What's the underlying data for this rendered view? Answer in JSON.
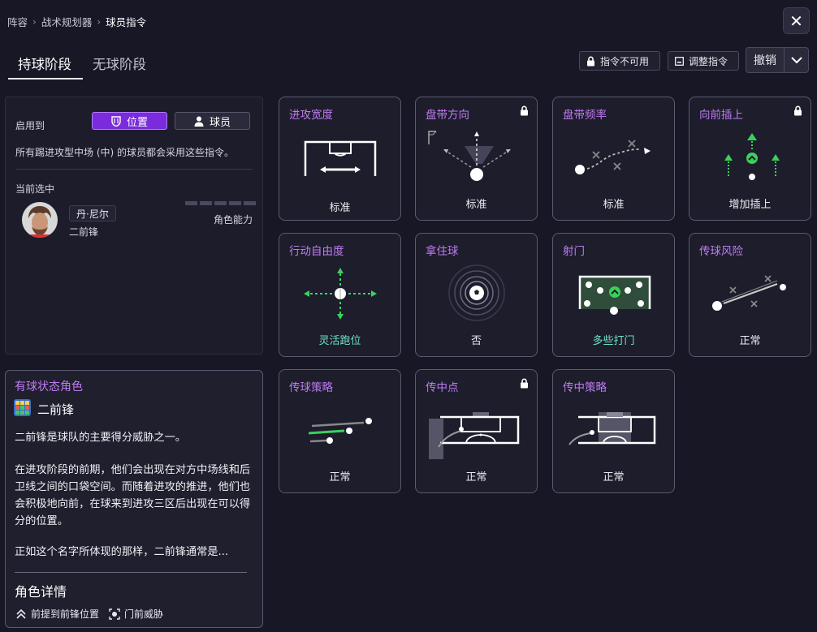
{
  "breadcrumb": [
    "阵容",
    "战术规划器",
    "球员指令"
  ],
  "tabs": [
    {
      "label": "持球阶段",
      "active": true
    },
    {
      "label": "无球阶段",
      "active": false
    }
  ],
  "toolbar": {
    "unavailable_label": "指令不可用",
    "adjust_label": "调整指令",
    "undo_label": "撤销"
  },
  "apply": {
    "label": "启用到",
    "position_label": "位置",
    "player_label": "球员",
    "description": "所有踢进攻型中场 (中) 的球员都会采用这些指令。"
  },
  "selection": {
    "label": "当前选中",
    "player_name": "丹·尼尔",
    "role": "二前锋",
    "ability_label": "角色能力"
  },
  "role_info": {
    "header": "有球状态角色",
    "role_name": "二前锋",
    "paragraphs": [
      "二前锋是球队的主要得分威胁之一。",
      "在进攻阶段的前期，他们会出现在对方中场线和后卫线之间的口袋空间。而随着进攻的推进，他们也会积极地向前，在球来到进攻三区后出现在可以得分的位置。",
      "正如这个名字所体现的那样，二前锋通常是..."
    ],
    "details_title": "角色详情",
    "traits": [
      "前提到前锋位置",
      "门前威胁"
    ]
  },
  "cards": [
    {
      "title": "进攻宽度",
      "value": "标准",
      "locked": false,
      "icon": "pitch-width-icon"
    },
    {
      "title": "盘带方向",
      "value": "标准",
      "locked": true,
      "icon": "dribble-direction-icon"
    },
    {
      "title": "盘带频率",
      "value": "标准",
      "locked": false,
      "icon": "dribble-frequency-icon"
    },
    {
      "title": "向前插上",
      "value": "增加插上",
      "locked": true,
      "icon": "forward-runs-icon"
    },
    {
      "title": "行动自由度",
      "value": "灵活跑位",
      "locked": false,
      "icon": "freedom-icon"
    },
    {
      "title": "拿住球",
      "value": "否",
      "locked": false,
      "icon": "hold-ball-icon"
    },
    {
      "title": "射门",
      "value": "多些打门",
      "locked": false,
      "icon": "shooting-icon"
    },
    {
      "title": "传球风险",
      "value": "正常",
      "locked": false,
      "icon": "pass-risk-icon"
    },
    {
      "title": "传球策略",
      "value": "正常",
      "locked": false,
      "icon": "pass-strategy-icon"
    },
    {
      "title": "传中点",
      "value": "正常",
      "locked": true,
      "icon": "cross-point-icon"
    },
    {
      "title": "传中策略",
      "value": "正常",
      "locked": false,
      "icon": "cross-strategy-icon"
    }
  ],
  "colors": {
    "accent": "#7a2bdc",
    "title_purple": "#c07bf2",
    "highlight_green": "#6fe3c8",
    "arrow_green": "#3ad15a",
    "background": "#171726"
  }
}
